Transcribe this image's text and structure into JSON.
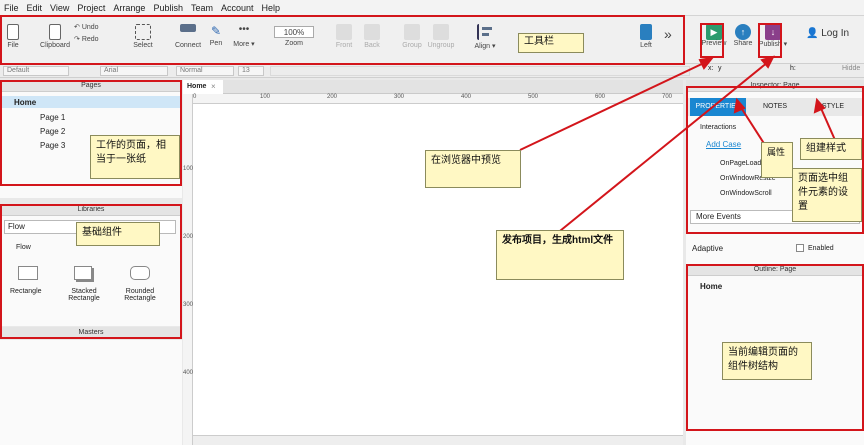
{
  "menu": [
    "File",
    "Edit",
    "View",
    "Project",
    "Arrange",
    "Publish",
    "Team",
    "Account",
    "Help"
  ],
  "toolbar": {
    "file": "File",
    "clipboard": "Clipboard",
    "undo": "Undo",
    "redo": "Redo",
    "select": "Select",
    "connect": "Connect",
    "pen": "Pen",
    "more": "More ▾",
    "zoom_value": "100%",
    "zoom_label": "Zoom",
    "front": "Front",
    "back": "Back",
    "group": "Group",
    "ungroup": "Ungroup",
    "align": "Align ▾",
    "left": "Left",
    "preview": "Preview",
    "share": "Share",
    "publish": "Publish ▾",
    "login": "Log In"
  },
  "format": {
    "style": "Default",
    "font": "Arial",
    "weight": "Normal",
    "size": "13",
    "x_label": "x:",
    "y_label": "y",
    "h_label": "h:",
    "hidden_label": "Hidde"
  },
  "pages": {
    "title": "Pages",
    "items": [
      "Home",
      "Page 1",
      "Page 2",
      "Page 3"
    ]
  },
  "libraries": {
    "title": "Libraries",
    "selected": "Flow",
    "group": "Flow",
    "shapes": [
      "Rectangle",
      "Stacked Rectangle",
      "Rounded Rectangle"
    ]
  },
  "masters": {
    "title": "Masters"
  },
  "canvas": {
    "tab": "Home",
    "ruler_h": [
      "0",
      "100",
      "200",
      "300",
      "400",
      "500",
      "600",
      "700"
    ],
    "ruler_v": [
      "100",
      "200",
      "300",
      "400"
    ]
  },
  "inspector": {
    "title": "Inspector: Page",
    "tabs": [
      "PROPERTIES",
      "NOTES",
      "STYLE"
    ],
    "section": "Interactions",
    "add_case": "Add Case",
    "events": [
      "OnPageLoad",
      "OnWindowResize",
      "OnWindowScroll"
    ],
    "more_events": "More Events",
    "adaptive": "Adaptive",
    "enabled": "Enabled"
  },
  "outline": {
    "title": "Outline: Page",
    "root": "Home"
  },
  "annotations": {
    "toolbar": "工具栏",
    "pages": "工作的页面，相当于一张纸",
    "libraries": "基础组件",
    "preview": "在浏览器中预览",
    "publish": "发布项目，生成html文件",
    "properties": "属性",
    "style": "组建样式",
    "selected": "页面选中组件元素的设置",
    "outline": "当前编辑页面的组件树结构"
  },
  "colors": {
    "accent": "#1a87d1",
    "annotation_border": "#d3151b",
    "note_bg": "#fff8c4",
    "preview_green": "#2c9b6e"
  }
}
